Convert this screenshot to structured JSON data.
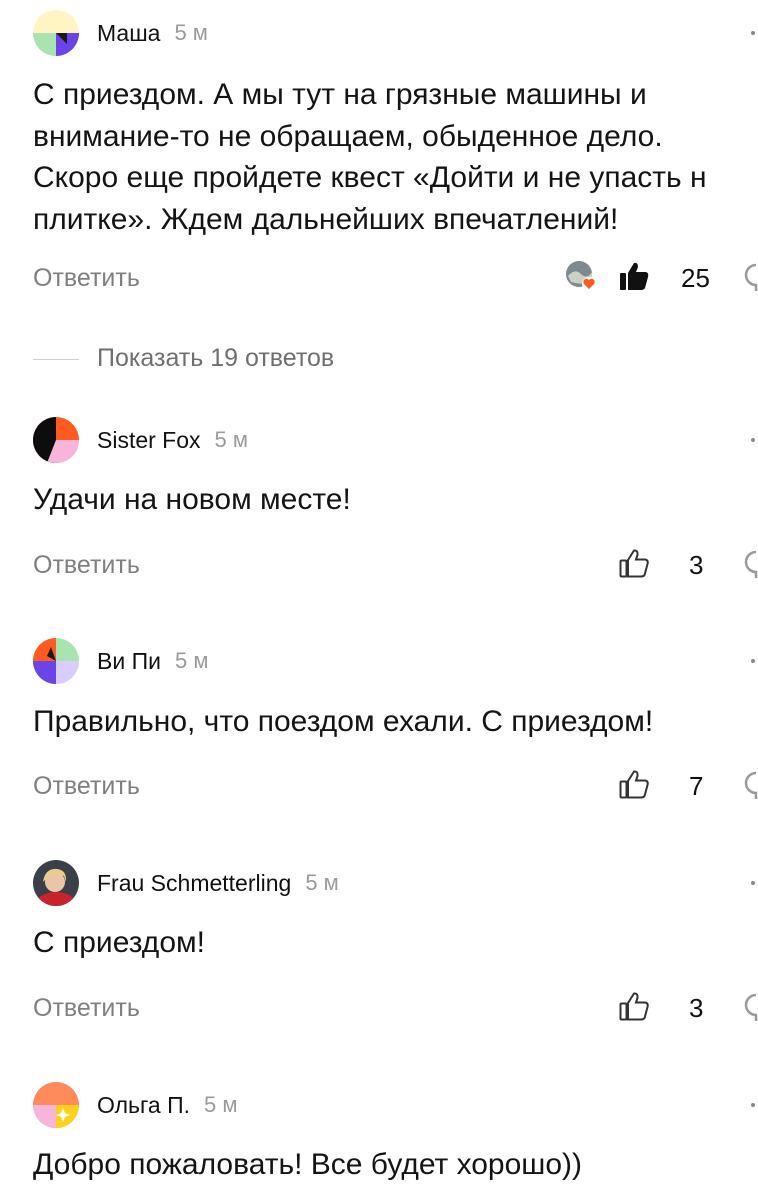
{
  "comments": [
    {
      "author": "Маша",
      "time": "5 м",
      "text": "С приездом. А мы тут на грязные машины и\nвнимание-то не обращаем, обыденное дело.\nСкоро еще пройдете квест «Дойти и не упасть н\nплитке». Ждем дальнейших впечатлений!",
      "reply_label": "Ответить",
      "likes": "25",
      "liked": true
    },
    {
      "author": "Sister Fox",
      "time": "5 м",
      "text": "Удачи на новом месте!",
      "reply_label": "Ответить",
      "likes": "3",
      "liked": false
    },
    {
      "author": "Ви Пи",
      "time": "5 м",
      "text": "Правильно, что поездом ехали. С приездом!",
      "reply_label": "Ответить",
      "likes": "7",
      "liked": false
    },
    {
      "author": "Frau Schmetterling",
      "time": "5 м",
      "text": "С приездом!",
      "reply_label": "Ответить",
      "likes": "3",
      "liked": false
    },
    {
      "author": "Ольга П.",
      "time": "5 м",
      "text": "Добро пожаловать! Все будет хорошо))"
    }
  ],
  "show_replies": {
    "label": "Показать 19 ответов"
  },
  "icons": {
    "like": "thumbs-up-icon",
    "comment": "comment-bubble-icon",
    "more": "more-dots-icon"
  },
  "colors": {
    "reply_text": "#7f7f7f",
    "time_text": "#9a9a9a",
    "reaction_heart": "#ff5a1f"
  }
}
